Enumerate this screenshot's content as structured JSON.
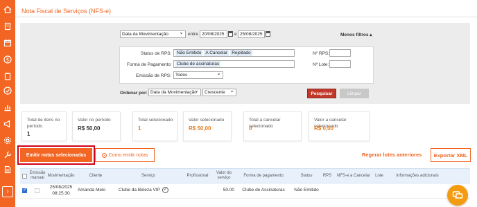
{
  "page": {
    "title": "Nota Fiscal de Serviços (NFS-e)"
  },
  "sidebar": {
    "icons": [
      "home-icon",
      "building-icon",
      "calendar-icon",
      "dollar-icon",
      "clipboard-icon",
      "check-circle-icon",
      "chart-icon",
      "megaphone-icon",
      "gear-icon",
      "tools-icon",
      "document-icon"
    ],
    "expand_symbol": "›"
  },
  "filters": {
    "date_type": "Data da Movimentação",
    "between_label": "entre",
    "start_date": "20/08/2025",
    "and_label": "e",
    "end_date": "25/08/2025",
    "less_filters": "Menos filtros ▴",
    "rps_status_label": "Status de RPS:",
    "rps_status_chips": [
      "Não Emitido",
      "A Cancelar",
      "Rejeitado"
    ],
    "payment_label": "Forma de Pagamento:",
    "payment_chips": [
      "Clube de assinaturas"
    ],
    "emission_label": "Emissão de RPS:",
    "emission_value": "Todos",
    "rps_number_label": "Nº RPS:",
    "batch_label": "Nº Lote:",
    "order_label": "Ordenar por:",
    "order_field": "Data da Movimentação",
    "order_direction": "Crescente",
    "search_button": "Pesquisar",
    "clear_button": "Limpar"
  },
  "stats": [
    {
      "label": "Total de itens no período",
      "value": "1"
    },
    {
      "label": "Valor no período",
      "value": "R$ 50,00"
    },
    {
      "label": "Total selecionado",
      "value": "1"
    },
    {
      "label": "Valor selecionado",
      "value": "R$ 50,00"
    },
    {
      "label": "Total a cancelar selecionado",
      "value": "0"
    },
    {
      "label": "Valor a cancelar selecionado",
      "value": "R$ 0,00"
    }
  ],
  "actions": {
    "emit_selected": "Emitir notas selecionadas",
    "how_to_emit": "Como emitir notas",
    "regenerate_batches": "Regerar lotes anteriores",
    "export_xml": "Exportar XML"
  },
  "table": {
    "headers": {
      "manual": "Emissão manual",
      "movement": "Movimentação",
      "client": "Cliente",
      "service": "Serviço",
      "professional": "Profissional",
      "service_value": "Valor do serviço",
      "payment_method": "Forma de pagamento",
      "status": "Status",
      "rps": "RPS",
      "nfse_cancel": "NFS-e a Cancelar",
      "batch": "Lote",
      "additional_info": "Informações adicionais"
    },
    "rows": [
      {
        "date": "25/08/2025",
        "time": "08:25:30",
        "client": "Amanda Melo",
        "service": "Clube da Beleza VIP",
        "professional": "",
        "value": "50.00",
        "payment": "Clube de Assinaturas",
        "status": "Não Emitido",
        "rps": "",
        "nfse_cancel": "",
        "batch": "",
        "info": ""
      }
    ]
  },
  "colors": {
    "brand": "#f26522",
    "primary_button": "#c0392b",
    "highlight_outline": "#d0021b",
    "table_header": "#e8f1fb",
    "chat": "#f39c12"
  }
}
